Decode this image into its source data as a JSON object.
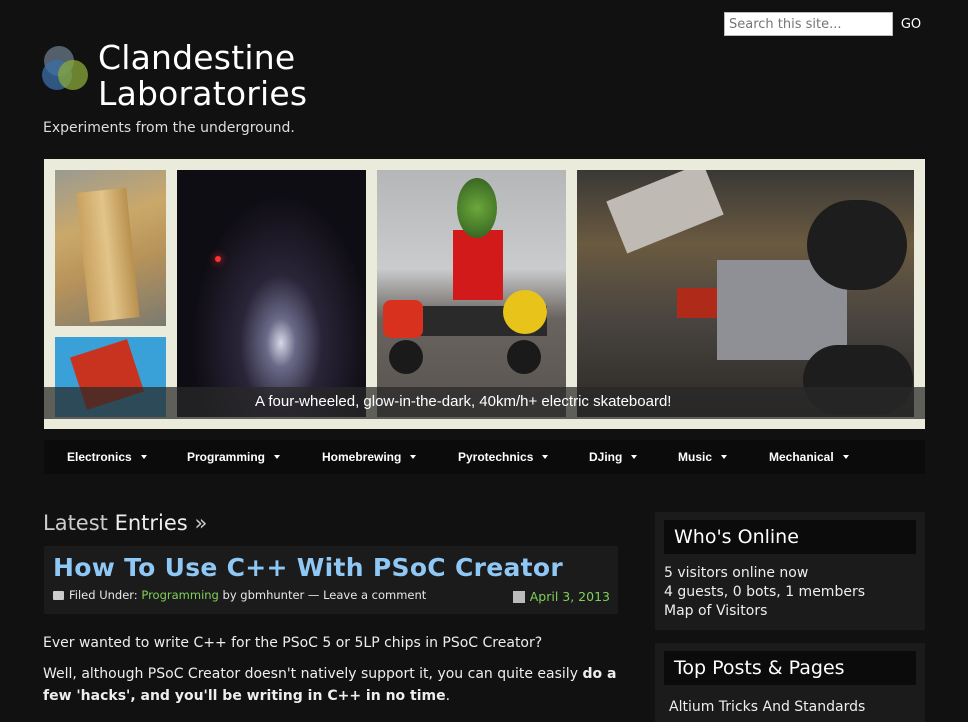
{
  "search": {
    "placeholder": "Search this site...",
    "button": "GO"
  },
  "site": {
    "title_line1": "Clandestine",
    "title_line2": "Laboratories",
    "tagline": "Experiments from the underground."
  },
  "banner": {
    "caption": "A four-wheeled, glow-in-the-dark, 40km/h+ electric skateboard!"
  },
  "nav": [
    {
      "label": "Electronics"
    },
    {
      "label": "Programming"
    },
    {
      "label": "Homebrewing"
    },
    {
      "label": "Pyrotechnics"
    },
    {
      "label": "DJing"
    },
    {
      "label": "Music"
    },
    {
      "label": "Mechanical"
    }
  ],
  "latest": {
    "word1": "Latest",
    "word2": "Entries",
    "arrow": "»"
  },
  "post": {
    "title": "How To Use C++ With PSoC Creator",
    "filed_under": "Filed Under:",
    "category": "Programming",
    "by": "by gbmhunter —",
    "comment": "Leave a comment",
    "date": "April 3, 2013",
    "p1": "Ever wanted to write C++ for the PSoC 5 or 5LP chips in PSoC Creator?",
    "p2a": "Well, although PSoC Creator doesn't natively support it, you can quite easily ",
    "p2b": "do a few 'hacks', and you'll be writing in C++ in no time",
    "p2c": "."
  },
  "whos_online": {
    "title": "Who's Online",
    "line1": "5 visitors online now",
    "line2": "4 guests, 0 bots, 1 members",
    "link": "Map of Visitors"
  },
  "top_posts": {
    "title": "Top Posts & Pages",
    "item1": "Altium Tricks And Standards"
  },
  "colors": {
    "link_green": "#7fd05a",
    "title_blue": "#8fc7f5",
    "background": "#111112"
  }
}
